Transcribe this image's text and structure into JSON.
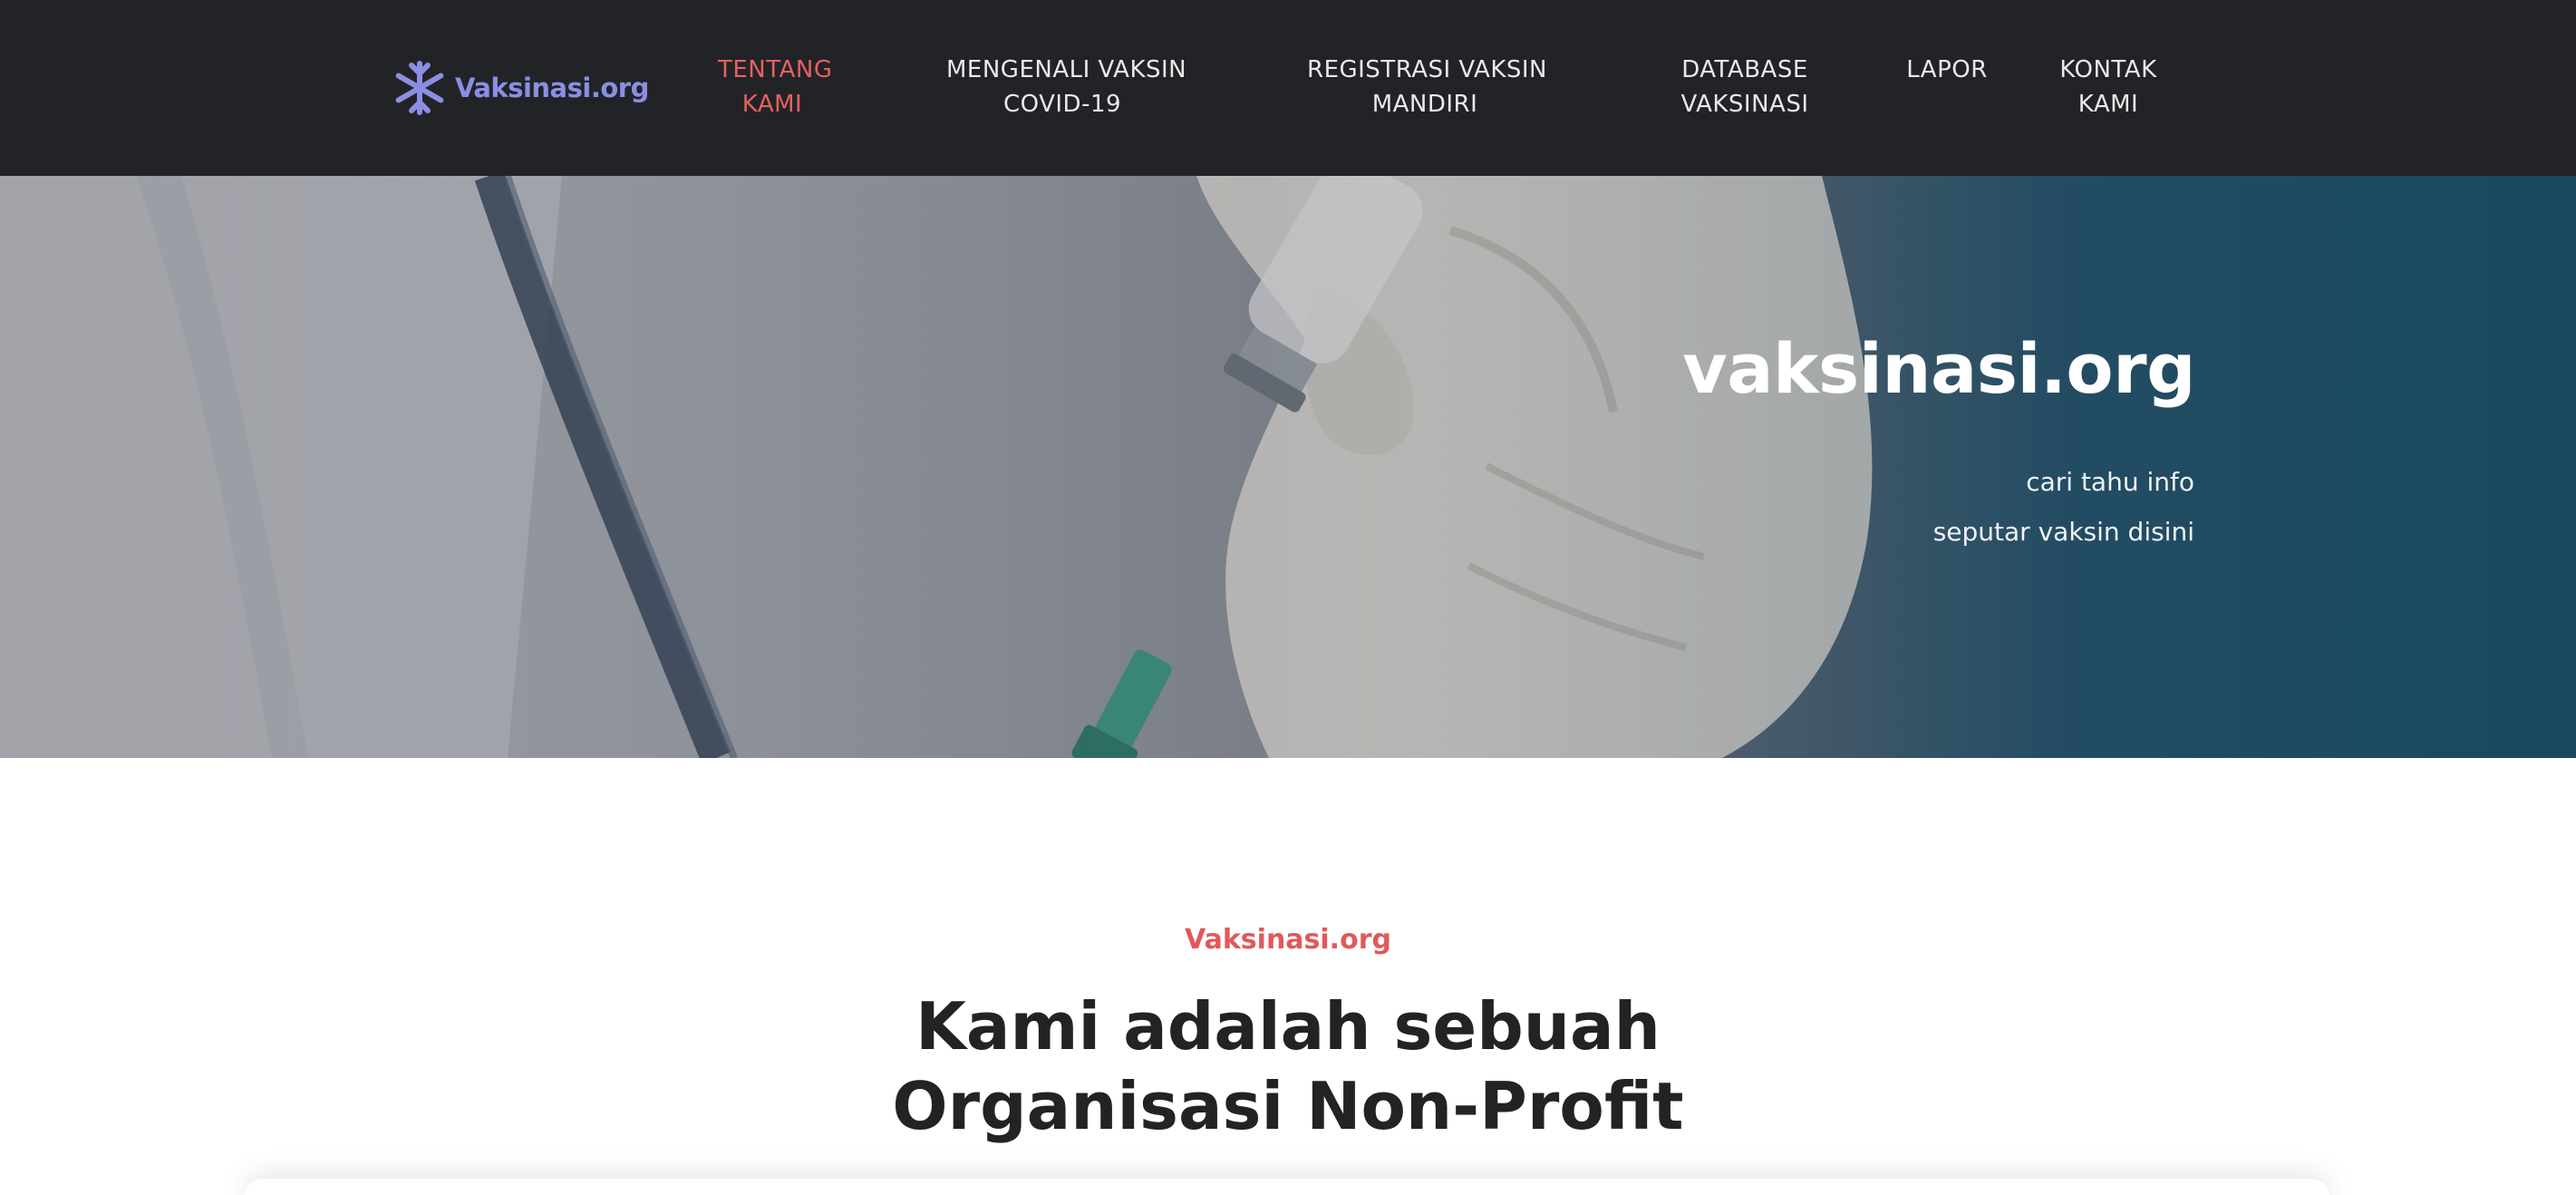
{
  "brand": {
    "name": "Vaksinasi.org",
    "accent": "#8a8fe3"
  },
  "nav": {
    "items": [
      {
        "line1": "TENTANG",
        "line2": "KAMI",
        "active": true
      },
      {
        "line1": "MENGENALI VAKSIN",
        "line2": "COVID-19",
        "active": false
      },
      {
        "line1": "REGISTRASI VAKSIN",
        "line2": "MANDIRI",
        "active": false
      },
      {
        "line1": "DATABASE",
        "line2": "VAKSINASI",
        "active": false
      },
      {
        "line1": "LAPOR",
        "line2": "",
        "active": false
      },
      {
        "line1": "KONTAK",
        "line2": "KAMI",
        "active": false
      }
    ],
    "active_color": "#e4625f"
  },
  "hero": {
    "title": "vaksinasi.org",
    "subtitle_line1": "cari tahu info",
    "subtitle_line2": "seputar vaksin disini"
  },
  "about": {
    "eyebrow": "Vaksinasi.org",
    "headline_line1": "Kami adalah sebuah",
    "headline_line2": "Organisasi Non-Profit"
  },
  "icons": [
    "snowflake-logo-icon"
  ]
}
